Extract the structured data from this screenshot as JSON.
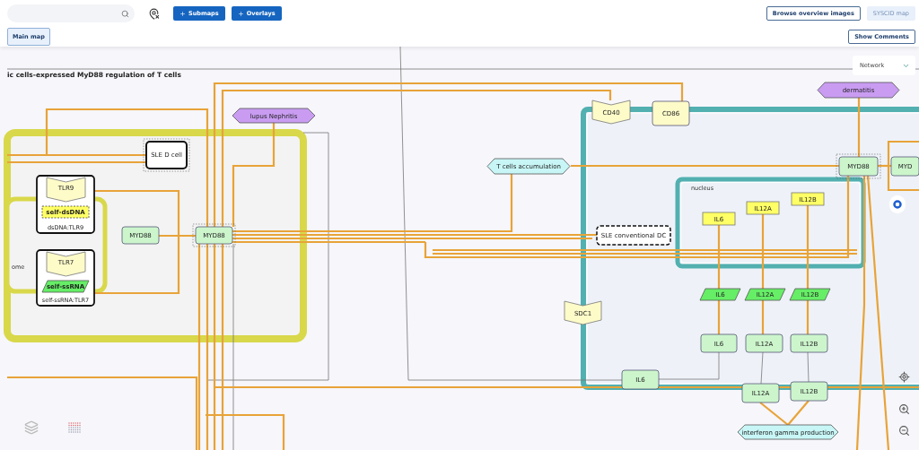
{
  "toolbar": {
    "buttons": [
      {
        "label": "Submaps"
      },
      {
        "label": "Overlays"
      }
    ],
    "right_buttons": [
      {
        "label": "Browse overview images",
        "disabled": false
      },
      {
        "label": "SYSCID map",
        "disabled": true
      }
    ]
  },
  "tabs": [
    {
      "label": "Main map",
      "selected": true
    }
  ],
  "show_comments": "Show Comments",
  "layer_select": {
    "value": "Network"
  },
  "map_title": "ic cells-expressed MyD88 regulation of T cells",
  "diagram": {
    "compartments": [
      {
        "kind": "membrane",
        "color": "#d8d84a"
      },
      {
        "kind": "membrane",
        "label": "ome",
        "color": "#d8d84a"
      },
      {
        "kind": "cell",
        "color": "#52b0b0"
      },
      {
        "kind": "cell",
        "label": "nucleus",
        "color": "#52b0b0"
      }
    ],
    "nodes": [
      {
        "kind": "phenotype",
        "label": "lupus Nephritis",
        "color": "#c99cf2",
        "active": false
      },
      {
        "kind": "cell",
        "label": "SLE D cell",
        "active": true
      },
      {
        "kind": "complex",
        "label": "dsDNA:TLR9",
        "active": false,
        "members": [
          {
            "kind": "receptor",
            "label": "TLR9"
          },
          {
            "kind": "dna",
            "label": "self-dsDNA"
          }
        ]
      },
      {
        "kind": "complex",
        "label": "self-ssRNA:TLR7",
        "active": false,
        "members": [
          {
            "kind": "receptor",
            "label": "TLR7"
          },
          {
            "kind": "rna",
            "label": "self-ssRNA"
          }
        ]
      },
      {
        "kind": "protein",
        "label": "MYD88",
        "color": "#ccf5cc",
        "active": false
      },
      {
        "kind": "protein",
        "label": "MYD88",
        "color": "#ccf5cc",
        "active": true
      },
      {
        "kind": "receptor",
        "label": "CD40",
        "color": "#fdfbc8",
        "active": false
      },
      {
        "kind": "protein",
        "label": "CD86",
        "color": "#fdfbc8",
        "active": false
      },
      {
        "kind": "phenotype",
        "label": "T cells accumulation",
        "color": "#c8f6f6",
        "active": false
      },
      {
        "kind": "dashed",
        "label": "SLE conventional DC",
        "active": false
      },
      {
        "kind": "receptor",
        "label": "SDC1",
        "color": "#fdfbc8",
        "active": false
      },
      {
        "kind": "phenotype",
        "label": "dermatitis",
        "color": "#c99cf2",
        "active": false
      },
      {
        "kind": "protein",
        "label": "MYD88",
        "color": "#ccf5cc",
        "active": true
      },
      {
        "kind": "protein",
        "label": "MYD",
        "color": "#ccf5cc",
        "active": false
      },
      {
        "kind": "gene",
        "label": "IL6",
        "color": "#ffff66",
        "active": false
      },
      {
        "kind": "gene",
        "label": "IL12A",
        "color": "#ffff66",
        "active": false
      },
      {
        "kind": "gene",
        "label": "IL12B",
        "color": "#ffff66",
        "active": false
      },
      {
        "kind": "rna",
        "label": "IL6",
        "color": "#66ee66",
        "active": false
      },
      {
        "kind": "rna",
        "label": "IL12A",
        "color": "#66ee66",
        "active": false
      },
      {
        "kind": "rna",
        "label": "IL12B",
        "color": "#66ee66",
        "active": false
      },
      {
        "kind": "protein",
        "label": "IL6",
        "color": "#ccf5cc",
        "active": false
      },
      {
        "kind": "protein",
        "label": "IL12A",
        "color": "#ccf5cc",
        "active": false
      },
      {
        "kind": "protein",
        "label": "IL12B",
        "color": "#ccf5cc",
        "active": false
      },
      {
        "kind": "protein",
        "label": "IL6",
        "color": "#ccf5cc",
        "active": false
      },
      {
        "kind": "protein",
        "label": "IL12A",
        "color": "#ccf5cc",
        "active": false
      },
      {
        "kind": "protein",
        "label": "IL12B",
        "color": "#ccf5cc",
        "active": false
      },
      {
        "kind": "phenotype",
        "label": "interferon gamma production",
        "color": "#c8f6f6",
        "active": false
      }
    ]
  }
}
